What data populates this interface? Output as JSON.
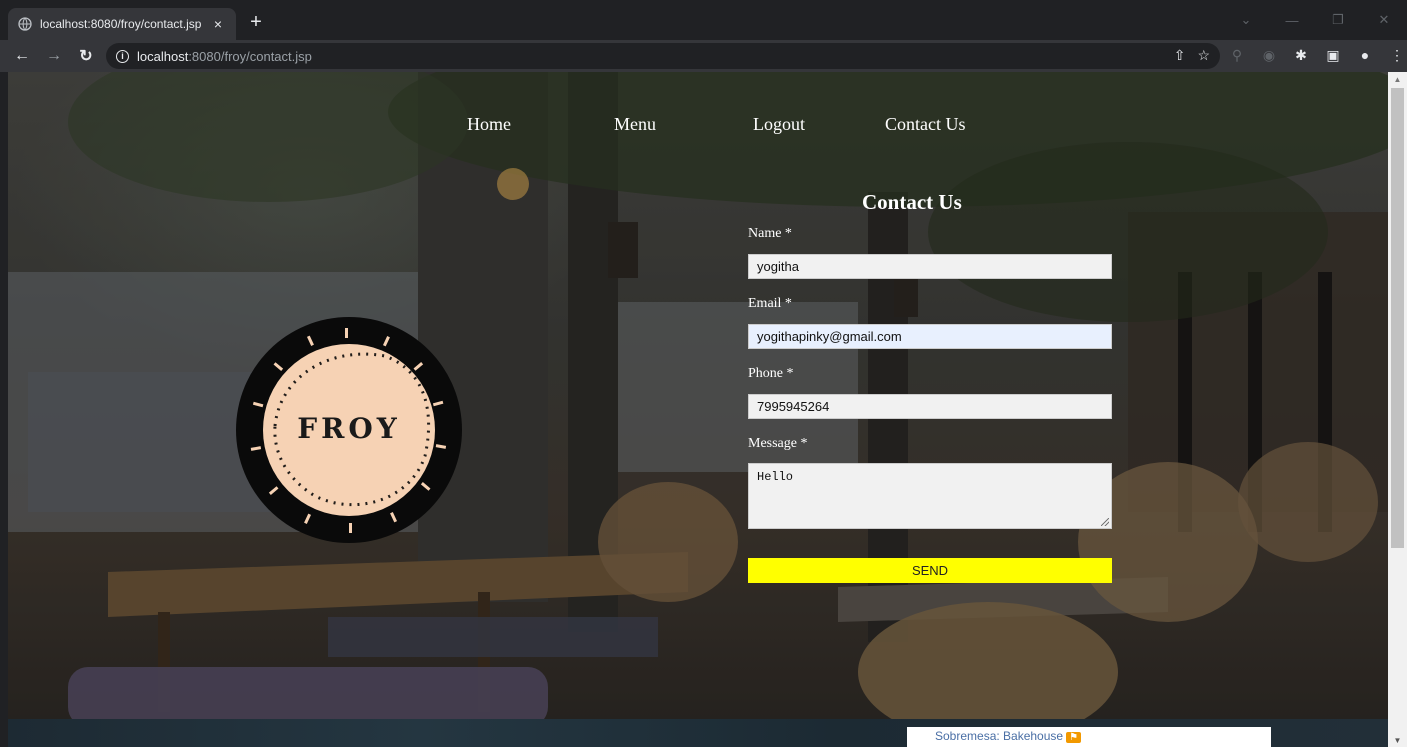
{
  "browser": {
    "tab_title": "localhost:8080/froy/contact.jsp",
    "tab_close": "×",
    "new_tab": "+",
    "url_host": "localhost",
    "url_rest": ":8080/froy/contact.jsp",
    "icons": [
      "back-icon",
      "forward-icon",
      "reload-icon",
      "info-icon",
      "share-icon",
      "star-icon",
      "extensions-icon",
      "side-panel-icon",
      "profile-icon",
      "menu-icon"
    ]
  },
  "nav": {
    "home": "Home",
    "menu": "Menu",
    "logout": "Logout",
    "contact": "Contact Us"
  },
  "logo": {
    "text": "FROY"
  },
  "form": {
    "title": "Contact Us",
    "name_label": "Name *",
    "name_value": "yogitha",
    "email_label": "Email *",
    "email_value": "yogithapinky@gmail.com",
    "phone_label": "Phone *",
    "phone_value": "7995945264",
    "message_label": "Message *",
    "message_value": "Hello",
    "send_label": "SEND"
  },
  "footer": {
    "map_text": "Sobremesa: Bakehouse"
  },
  "colors": {
    "send_button": "#ffff00",
    "logo_ring": "#0a0a0a",
    "logo_fill": "#f6d2b4"
  }
}
